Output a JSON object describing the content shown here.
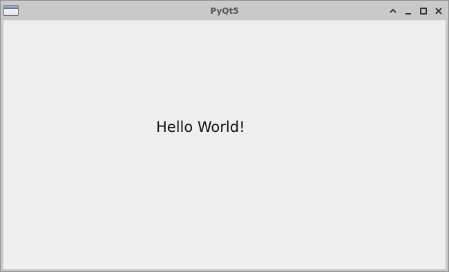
{
  "window": {
    "title": "PyQt5",
    "icons": {
      "app": "window-app-icon",
      "shade": "chevron-up-icon",
      "minimize": "minimize-icon",
      "maximize": "maximize-icon",
      "close": "close-icon"
    }
  },
  "content": {
    "label_text": "Hello World!"
  },
  "colors": {
    "titlebar_bg": "#c9c9c9",
    "client_bg": "#efefef",
    "title_text": "#555555",
    "label_text": "#111111"
  }
}
